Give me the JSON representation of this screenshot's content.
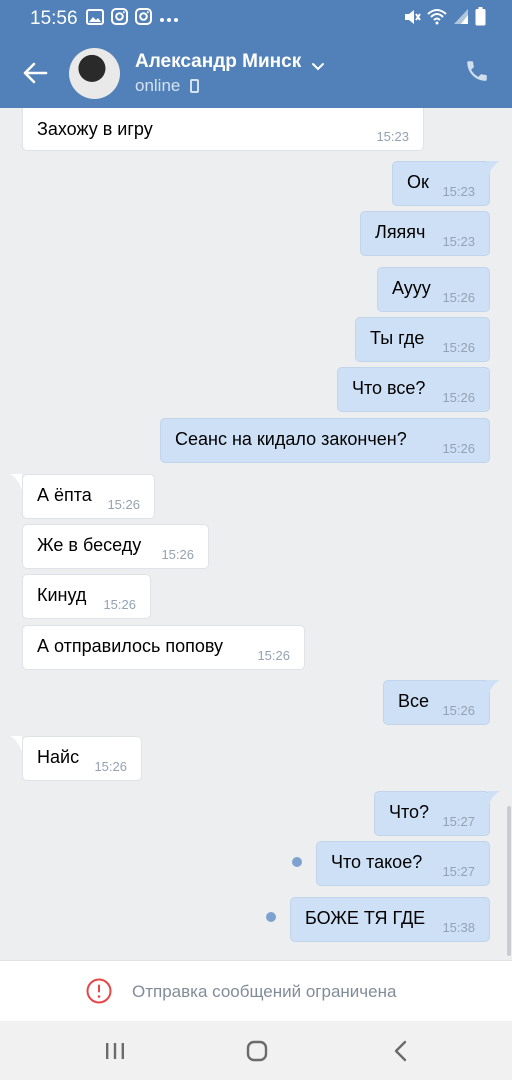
{
  "status_bar": {
    "time": "15:56",
    "left_icons": [
      "gallery-icon",
      "instagram-icon",
      "instagram-icon",
      "more-icon"
    ],
    "right_icons": [
      "mute-icon",
      "wifi-icon",
      "signal-icon",
      "battery-icon"
    ]
  },
  "header": {
    "contact_name": "Александр Минск",
    "status": "online",
    "accent_color": "#5181b8"
  },
  "messages": [
    {
      "dir": "in",
      "text": "Захожу в игру",
      "time": "15:23"
    },
    {
      "dir": "out",
      "text": "Ок",
      "time": "15:23"
    },
    {
      "dir": "out",
      "text": "Ляяяч",
      "time": "15:23"
    },
    {
      "dir": "out",
      "text": "Аууу",
      "time": "15:26"
    },
    {
      "dir": "out",
      "text": "Ты где",
      "time": "15:26"
    },
    {
      "dir": "out",
      "text": "Что все?",
      "time": "15:26"
    },
    {
      "dir": "out",
      "text": "Сеанс на кидало закончен?",
      "time": "15:26"
    },
    {
      "dir": "in",
      "text": "А ёпта",
      "time": "15:26"
    },
    {
      "dir": "in",
      "text": "Же в беседу",
      "time": "15:26"
    },
    {
      "dir": "in",
      "text": "Кинуд",
      "time": "15:26"
    },
    {
      "dir": "in",
      "text": "А отправилось попову",
      "time": "15:26"
    },
    {
      "dir": "out",
      "text": "Все",
      "time": "15:26"
    },
    {
      "dir": "in",
      "text": "Найс",
      "time": "15:26"
    },
    {
      "dir": "out",
      "text": "Что?",
      "time": "15:27"
    },
    {
      "dir": "out",
      "text": "Что такое?",
      "time": "15:27",
      "unread": true
    },
    {
      "dir": "out",
      "text": "БОЖЕ ТЯ ГДЕ",
      "time": "15:38",
      "unread": true
    }
  ],
  "footer": {
    "restricted_text": "Отправка сообщений ограничена"
  },
  "nav": [
    "recents-icon",
    "home-icon",
    "back-icon"
  ],
  "colors": {
    "incoming_bubble": "#ffffff",
    "outgoing_bubble": "#cee0f6",
    "background": "#edeef0"
  }
}
